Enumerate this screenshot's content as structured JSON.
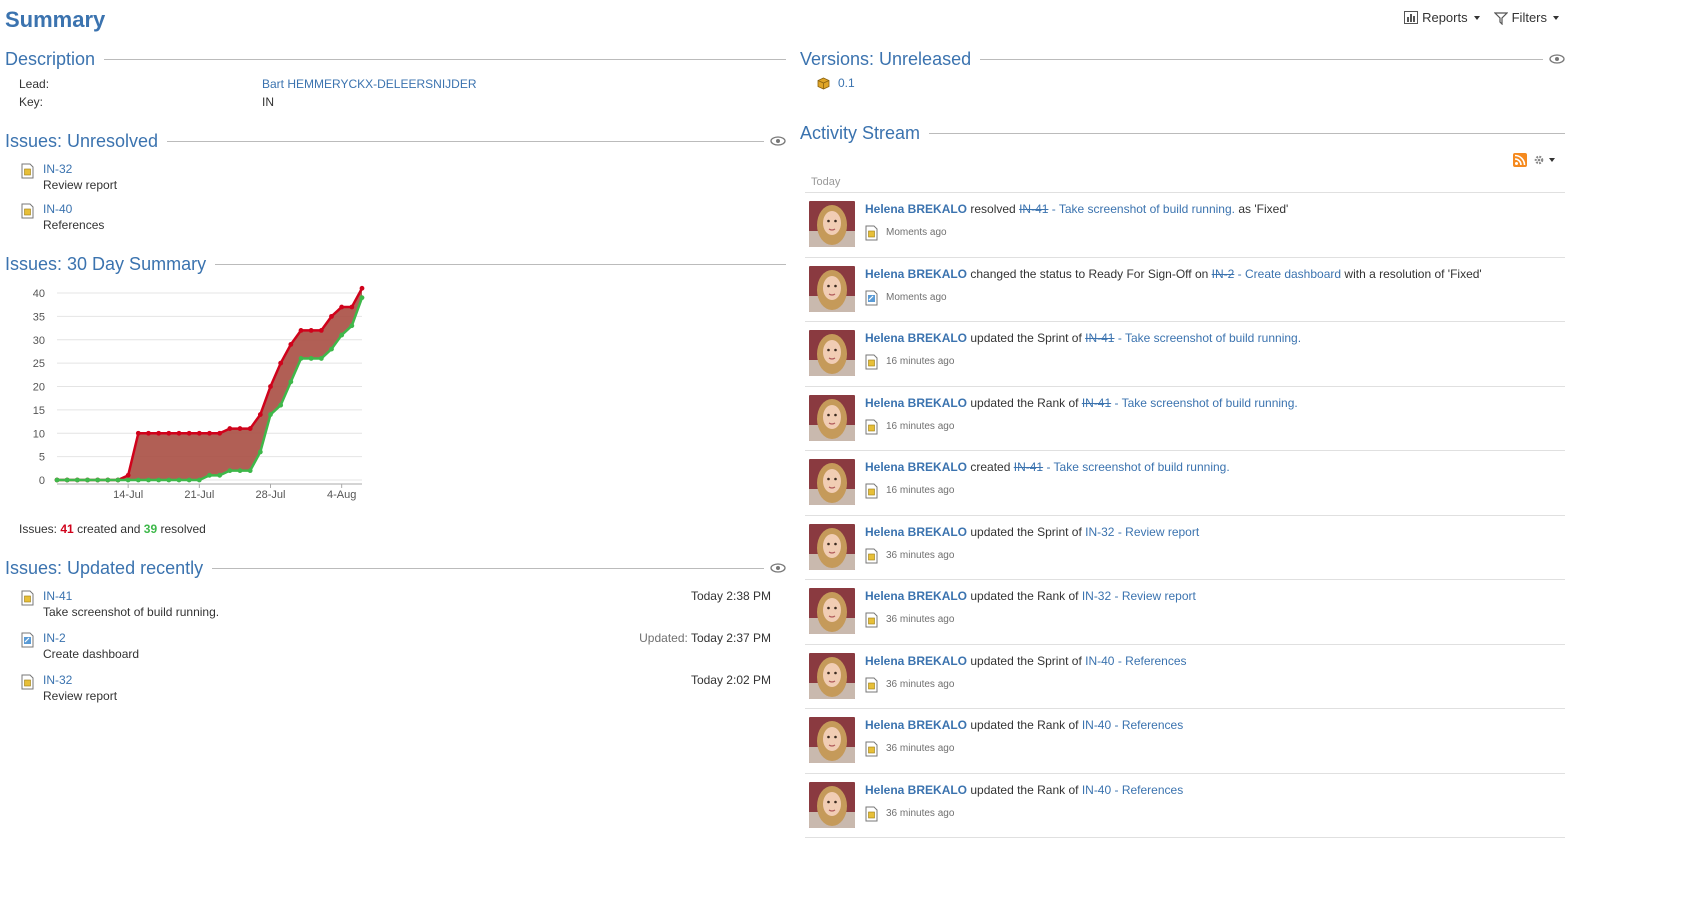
{
  "page": {
    "title": "Summary"
  },
  "toolbar": {
    "reports_label": "Reports",
    "filters_label": "Filters"
  },
  "description": {
    "title": "Description",
    "lead_label": "Lead:",
    "lead_value": "Bart HEMMERYCKX-DELEERSNIJDER",
    "key_label": "Key:",
    "key_value": "IN"
  },
  "unresolved": {
    "title": "Issues: Unresolved",
    "items": [
      {
        "key": "IN-32",
        "summary": "Review report",
        "icon": "task-icon"
      },
      {
        "key": "IN-40",
        "summary": "References",
        "icon": "task-icon"
      }
    ]
  },
  "summary30": {
    "title": "Issues: 30 Day Summary",
    "caption_prefix": "Issues:",
    "created_count": "41",
    "created_word": "created and",
    "resolved_count": "39",
    "resolved_word": "resolved"
  },
  "chart_data": {
    "type": "area",
    "title": "",
    "xlabel": "",
    "ylabel": "",
    "ylim": [
      0,
      40
    ],
    "y_ticks": [
      0,
      5,
      10,
      15,
      20,
      25,
      30,
      35,
      40
    ],
    "x_tick_labels": [
      "14-Jul",
      "21-Jul",
      "28-Jul",
      "4-Aug"
    ],
    "x_tick_index": [
      7,
      14,
      21,
      28
    ],
    "x": [
      0,
      1,
      2,
      3,
      4,
      5,
      6,
      7,
      8,
      9,
      10,
      11,
      12,
      13,
      14,
      15,
      16,
      17,
      18,
      19,
      20,
      21,
      22,
      23,
      24,
      25,
      26,
      27,
      28,
      29,
      30
    ],
    "grid": true,
    "legend": "none",
    "series": [
      {
        "color": "#d0021b",
        "values": [
          0,
          0,
          0,
          0,
          0,
          0,
          0,
          1,
          10,
          10,
          10,
          10,
          10,
          10,
          10,
          10,
          10,
          11,
          11,
          11,
          14,
          20,
          25,
          29,
          32,
          32,
          32,
          35,
          37,
          37,
          41
        ]
      },
      {
        "color": "#3eb84a",
        "values": [
          0,
          0,
          0,
          0,
          0,
          0,
          0,
          0,
          0,
          0,
          0,
          0,
          0,
          0,
          0,
          1,
          1,
          2,
          2,
          2,
          6,
          14,
          16,
          21,
          26,
          26,
          26,
          28,
          31,
          33,
          39
        ]
      }
    ],
    "fill_color": "#a94e43"
  },
  "updated": {
    "title": "Issues: Updated recently",
    "items": [
      {
        "key": "IN-41",
        "summary": "Take screenshot of build running.",
        "date_label": "",
        "date": "Today 2:38 PM",
        "icon": "task-icon"
      },
      {
        "key": "IN-2",
        "summary": "Create dashboard",
        "date_label": "Updated:",
        "date": "Today 2:37 PM",
        "icon": "story-icon"
      },
      {
        "key": "IN-32",
        "summary": "Review report",
        "date_label": "",
        "date": "Today 2:02 PM",
        "icon": "task-icon"
      }
    ]
  },
  "versions": {
    "title": "Versions: Unreleased",
    "items": [
      {
        "name": "0.1"
      }
    ]
  },
  "activity": {
    "title": "Activity Stream",
    "day_label": "Today",
    "entries": [
      {
        "user": "Helena BREKALO",
        "pre": "resolved",
        "key": "IN-41",
        "key_struck": true,
        "link": "- Take screenshot of build running.",
        "post": "as 'Fixed'",
        "icon": "task-icon",
        "time": "Moments ago"
      },
      {
        "user": "Helena BREKALO",
        "pre": "changed the status to Ready For Sign-Off on",
        "key": "IN-2",
        "key_struck": true,
        "link": "- Create dashboard",
        "post": "with a resolution of 'Fixed'",
        "icon": "story-icon",
        "time": "Moments ago"
      },
      {
        "user": "Helena BREKALO",
        "pre": "updated the Sprint of",
        "key": "IN-41",
        "key_struck": true,
        "link": "- Take screenshot of build running.",
        "post": "",
        "icon": "task-icon",
        "time": "16 minutes ago"
      },
      {
        "user": "Helena BREKALO",
        "pre": "updated the Rank of",
        "key": "IN-41",
        "key_struck": true,
        "link": "- Take screenshot of build running.",
        "post": "",
        "icon": "task-icon",
        "time": "16 minutes ago"
      },
      {
        "user": "Helena BREKALO",
        "pre": "created",
        "key": "IN-41",
        "key_struck": true,
        "link": "- Take screenshot of build running.",
        "post": "",
        "icon": "task-icon",
        "time": "16 minutes ago"
      },
      {
        "user": "Helena BREKALO",
        "pre": "updated the Sprint of",
        "key": "IN-32",
        "key_struck": false,
        "link": "- Review report",
        "post": "",
        "icon": "task-icon",
        "time": "36 minutes ago"
      },
      {
        "user": "Helena BREKALO",
        "pre": "updated the Rank of",
        "key": "IN-32",
        "key_struck": false,
        "link": "- Review report",
        "post": "",
        "icon": "task-icon",
        "time": "36 minutes ago"
      },
      {
        "user": "Helena BREKALO",
        "pre": "updated the Sprint of",
        "key": "IN-40",
        "key_struck": false,
        "link": "- References",
        "post": "",
        "icon": "task-icon",
        "time": "36 minutes ago"
      },
      {
        "user": "Helena BREKALO",
        "pre": "updated the Rank of",
        "key": "IN-40",
        "key_struck": false,
        "link": "- References",
        "post": "",
        "icon": "task-icon",
        "time": "36 minutes ago"
      },
      {
        "user": "Helena BREKALO",
        "pre": "updated the Rank of",
        "key": "IN-40",
        "key_struck": false,
        "link": "- References",
        "post": "",
        "icon": "task-icon",
        "time": "36 minutes ago"
      }
    ]
  }
}
